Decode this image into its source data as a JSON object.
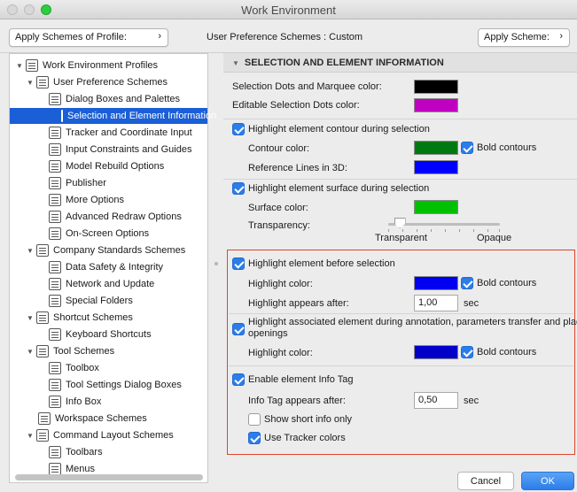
{
  "window": {
    "title": "Work Environment"
  },
  "topbar": {
    "profile_button": "Apply Schemes of Profile:",
    "scheme_label": "User Preference Schemes : Custom",
    "apply_scheme_button": "Apply Scheme:",
    "chevron": "›"
  },
  "tree": {
    "root": "Work Environment Profiles",
    "user_pref": "User Preference Schemes",
    "dialog_boxes": "Dialog Boxes and Palettes",
    "selection_info": "Selection and Element Information",
    "tracker": "Tracker and Coordinate Input",
    "input_constraints": "Input Constraints and Guides",
    "model_rebuild": "Model Rebuild Options",
    "publisher": "Publisher",
    "more_options": "More Options",
    "advanced_redraw": "Advanced Redraw Options",
    "onscreen": "On-Screen Options",
    "company": "Company Standards Schemes",
    "data_safety": "Data Safety & Integrity",
    "network": "Network and Update",
    "special_folders": "Special Folders",
    "shortcut": "Shortcut Schemes",
    "keyboard": "Keyboard Shortcuts",
    "tool_schemes": "Tool Schemes",
    "toolbox": "Toolbox",
    "tool_settings": "Tool Settings Dialog Boxes",
    "info_box": "Info Box",
    "workspace": "Workspace Schemes",
    "command_layout": "Command Layout Schemes",
    "toolbars": "Toolbars",
    "menus": "Menus"
  },
  "panel": {
    "header": "SELECTION AND ELEMENT INFORMATION",
    "selection_dots_label": "Selection Dots and Marquee color:",
    "editable_dots_label": "Editable Selection Dots color:",
    "highlight_contour": "Highlight element contour during selection",
    "contour_color_label": "Contour color:",
    "bold_contours": "Bold contours",
    "reference_lines": "Reference Lines in 3D:",
    "highlight_surface": "Highlight element surface during selection",
    "surface_color": "Surface color:",
    "transparency": "Transparency:",
    "transparent": "Transparent",
    "opaque": "Opaque",
    "highlight_before": "Highlight element before selection",
    "highlight_color": "Highlight color:",
    "highlight_appears": "Highlight appears after:",
    "highlight_delay": "1,00",
    "sec": "sec",
    "highlight_associated": "Highlight associated element during annotation, parameters transfer and placing",
    "highlight_associated_2": "openings",
    "highlight_color_2": "Highlight color:",
    "enable_info_tag": "Enable element Info Tag",
    "info_tag_appears": "Info Tag appears after:",
    "info_tag_delay": "0,50",
    "show_short_info": "Show short info only",
    "use_tracker_colors": "Use Tracker colors"
  },
  "colors": {
    "selection_dots": "#000000",
    "editable_dots": "#c000c0",
    "contour": "#007a10",
    "reference_lines": "#0000ff",
    "surface": "#00c000",
    "highlight": "#0000f0",
    "highlight_associated": "#0000c8",
    "accent": "#2b7de9"
  },
  "transparency_level": 0.1,
  "buttons": {
    "cancel": "Cancel",
    "ok": "OK"
  }
}
